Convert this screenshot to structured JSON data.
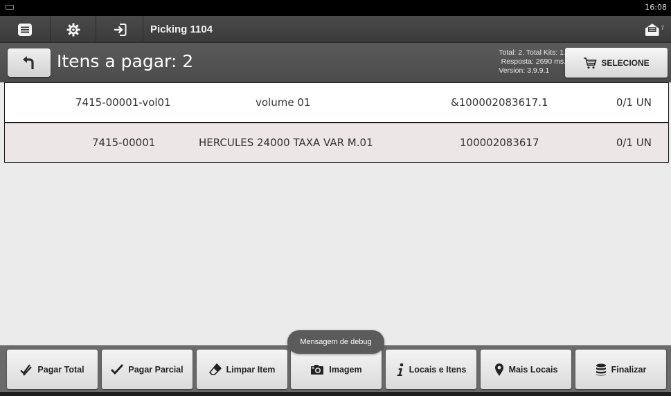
{
  "status_bar": {
    "time": "16:08",
    "keyboard_icon": "keyboard-icon"
  },
  "toolbar": {
    "icons": [
      "menu-icon",
      "gear-icon",
      "login-icon"
    ],
    "title": "Picking 1104",
    "message_icon": "message-icon"
  },
  "header": {
    "title": "Itens a pagar: 2",
    "info_line1": "Total: 2. Total Kits: 1.",
    "info_line2": "Resposta: 2690 ms.",
    "version": "Version: 3.9.9.1",
    "select_label": "SELECIONE"
  },
  "items": [
    {
      "code": "7415-00001-vol01",
      "description": "volume 01",
      "barcode": "&100002083617.1",
      "qty": "0/1 UN"
    },
    {
      "code": "7415-00001",
      "description": "HERCULES 24000 TAXA VAR M.01",
      "barcode": "100002083617",
      "qty": "0/1 UN"
    }
  ],
  "toast": "Mensagem de debug",
  "bottom_buttons": [
    {
      "label": "Pagar Total",
      "icon": "double-check-icon"
    },
    {
      "label": "Pagar Parcial",
      "icon": "check-icon"
    },
    {
      "label": "Limpar Item",
      "icon": "eraser-icon"
    },
    {
      "label": "Imagem",
      "icon": "camera-icon"
    },
    {
      "label": "Locais e Itens",
      "icon": "info-icon"
    },
    {
      "label": "Mais Locais",
      "icon": "location-pin-icon"
    },
    {
      "label": "Finalizar",
      "icon": "database-icon"
    }
  ],
  "colors": {
    "toolbar": "#3f3f3f",
    "header": "#525252",
    "row_alt": "#ece7e6",
    "bottom_bar": "#6b6b6b"
  }
}
